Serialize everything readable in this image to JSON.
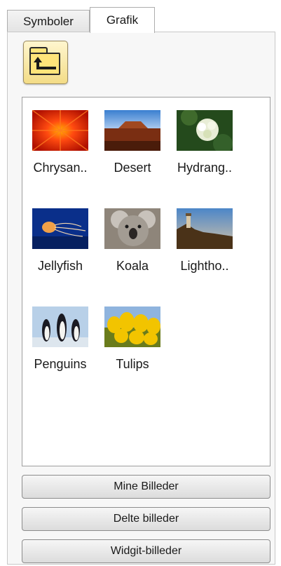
{
  "tabs": [
    {
      "label": "Symboler",
      "active": false
    },
    {
      "label": "Grafik",
      "active": true
    }
  ],
  "up_button": {
    "icon": "folder-up-icon"
  },
  "images": [
    {
      "label": "Chrysan..",
      "name": "chrysanthemum"
    },
    {
      "label": "Desert",
      "name": "desert"
    },
    {
      "label": "Hydrang..",
      "name": "hydrangeas"
    },
    {
      "label": "Jellyfish",
      "name": "jellyfish"
    },
    {
      "label": "Koala",
      "name": "koala"
    },
    {
      "label": "Lightho..",
      "name": "lighthouse"
    },
    {
      "label": "Penguins",
      "name": "penguins"
    },
    {
      "label": "Tulips",
      "name": "tulips"
    }
  ],
  "buttons": {
    "mine": "Mine Billeder",
    "delte": "Delte billeder",
    "widgit": "Widgit-billeder"
  }
}
